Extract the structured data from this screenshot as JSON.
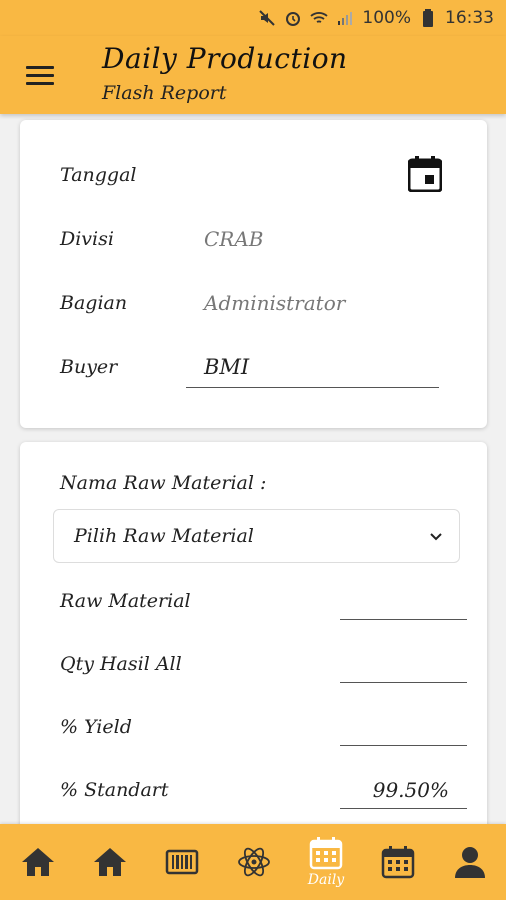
{
  "status_bar": {
    "battery": "100%",
    "time": "16:33"
  },
  "header": {
    "title": "Daily Production",
    "subtitle": "Flash Report"
  },
  "form": {
    "tanggal_label": "Tanggal",
    "divisi_label": "Divisi",
    "divisi_value": "CRAB",
    "bagian_label": "Bagian",
    "bagian_value": "Administrator",
    "buyer_label": "Buyer",
    "buyer_value": "BMI"
  },
  "material": {
    "section_label": "Nama Raw Material :",
    "dropdown_value": "Pilih Raw Material",
    "raw_material_label": "Raw Material",
    "raw_material_value": "",
    "qty_label": "Qty Hasil All",
    "qty_value": "",
    "yield_label": "% Yield",
    "yield_value": "",
    "standart_label": "% Standart",
    "standart_value": "99.50%"
  },
  "bottom_nav": {
    "items": [
      {
        "icon": "home-icon"
      },
      {
        "icon": "home-icon"
      },
      {
        "icon": "barcode-icon"
      },
      {
        "icon": "atom-icon"
      },
      {
        "icon": "calendar-icon",
        "label": "Daily",
        "active": true
      },
      {
        "icon": "calendar-icon"
      },
      {
        "icon": "person-icon"
      }
    ]
  },
  "colors": {
    "accent": "#f9b843",
    "active_nav": "#ffffff",
    "nav_icon": "#333333"
  }
}
